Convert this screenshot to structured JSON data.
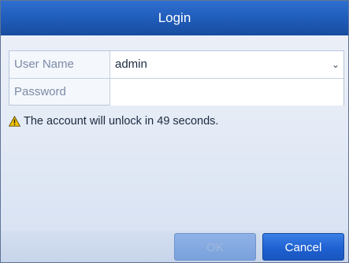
{
  "dialog": {
    "title": "Login"
  },
  "form": {
    "username": {
      "label": "User Name",
      "value": "admin",
      "icon": "chevron-down-icon"
    },
    "password": {
      "label": "Password",
      "value": ""
    }
  },
  "warning": {
    "icon": "warning-icon",
    "message": "The account will unlock in 49 seconds."
  },
  "buttons": {
    "ok_label": "OK",
    "cancel_label": "Cancel"
  },
  "colors": {
    "title_bar": "#1f5bb8",
    "primary_button": "#1d5fcf",
    "disabled_button": "#7aa1dc",
    "warning_yellow": "#f2c200"
  }
}
